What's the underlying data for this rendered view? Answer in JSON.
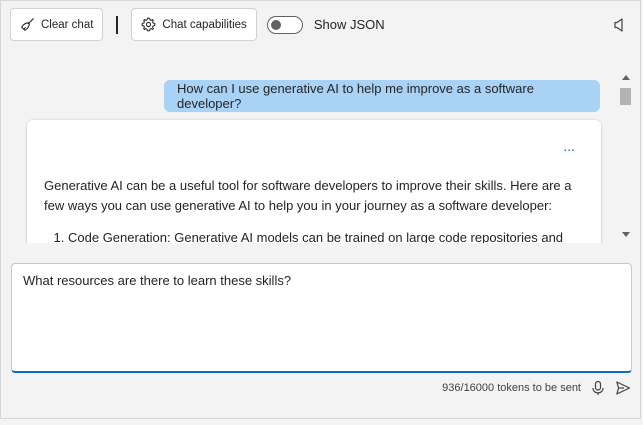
{
  "toolbar": {
    "clear_chat_label": "Clear chat",
    "chat_capabilities_label": "Chat capabilities",
    "show_json_label": "Show JSON",
    "show_json_on": false
  },
  "chat": {
    "user_message": "How can I use generative AI to help me improve as a software developer?",
    "bot_more": "...",
    "bot_paragraph": "Generative AI can be a useful tool for software developers to improve their skills. Here are a few ways you can use generative AI to help you in your journey as a software developer:",
    "bot_list": [
      "Code Generation: Generative AI models can be trained on large code repositories and"
    ]
  },
  "input": {
    "value": "What resources are there to learn these skills?"
  },
  "footer": {
    "tokens": "936/16000 tokens to be sent"
  },
  "colors": {
    "accent": "#0f6cbd",
    "user_bubble": "#a8d3f6"
  },
  "icons": {
    "clear_chat": "broom-icon",
    "chat_capabilities": "gear-icon",
    "speaker": "speaker-icon",
    "mic": "microphone-icon",
    "send": "send-icon"
  }
}
